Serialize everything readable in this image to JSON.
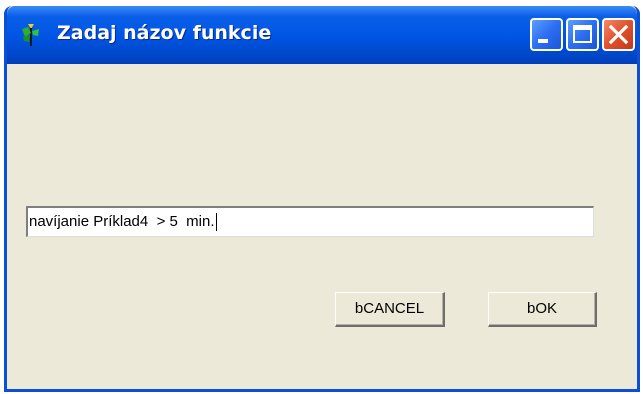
{
  "window": {
    "title": "Zadaj názov funkcie",
    "controls": {
      "minimize_icon": "minimize-icon",
      "maximize_icon": "maximize-icon",
      "close_icon": "close-icon"
    },
    "app_icon": "delphi-app-icon"
  },
  "form": {
    "function_name_value": "navíjanie Príklad4  > 5  min."
  },
  "buttons": {
    "cancel_label": "bCANCEL",
    "ok_label": "bOK"
  },
  "colors": {
    "titlebar": "#0054e3",
    "window_bg": "#ece9d8",
    "close_button": "#e0502c"
  }
}
